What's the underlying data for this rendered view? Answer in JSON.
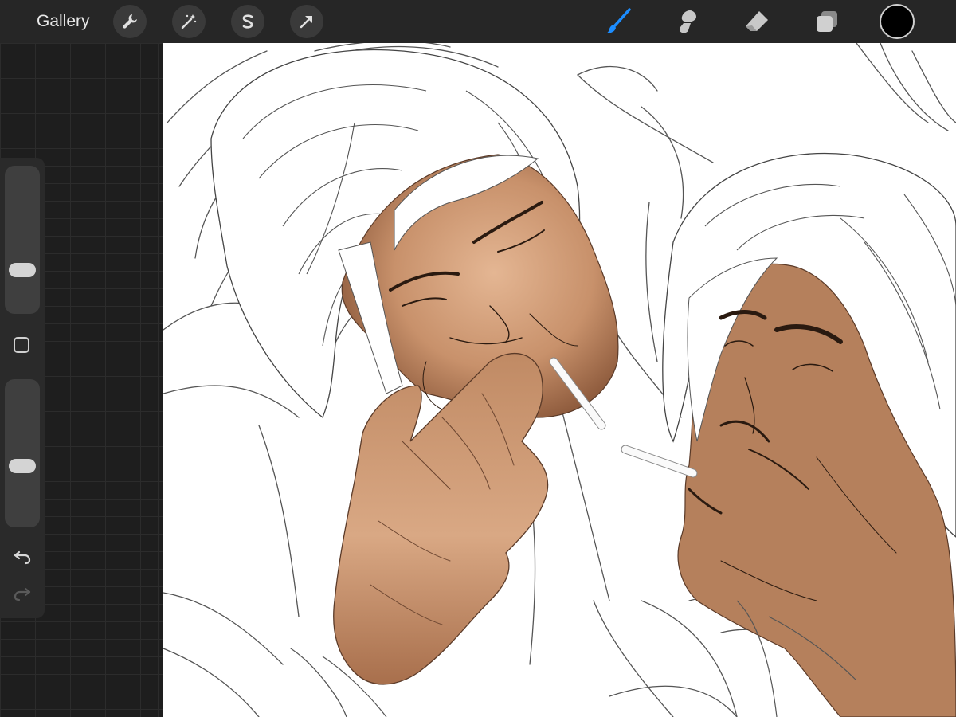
{
  "topbar": {
    "gallery_label": "Gallery",
    "action_buttons": [
      {
        "icon": "wrench-icon"
      },
      {
        "icon": "magic-wand-icon"
      },
      {
        "icon": "selection-s-icon"
      },
      {
        "icon": "transform-arrow-icon"
      }
    ],
    "tools": [
      {
        "icon": "brush-icon",
        "active": true,
        "color": "#1c8dff"
      },
      {
        "icon": "smudge-icon",
        "active": false
      },
      {
        "icon": "eraser-icon",
        "active": false
      },
      {
        "icon": "layers-icon",
        "active": false
      }
    ],
    "current_color": "#000000"
  },
  "sidebar": {
    "brush_size_level": 0.74,
    "opacity_level": 0.6,
    "modify_icon": "square-icon",
    "undo_icon": "undo-icon",
    "redo_icon": "redo-icon"
  },
  "canvas": {
    "background": "#ffffff",
    "skin_colors": [
      "#b88465",
      "#d6a27e",
      "#a87552"
    ]
  }
}
